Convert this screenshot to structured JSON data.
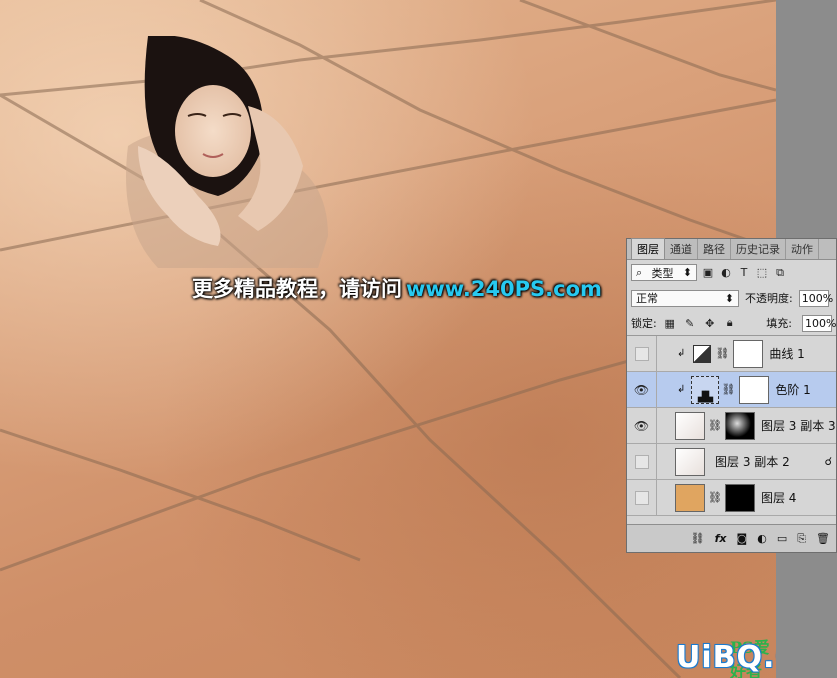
{
  "watermark": {
    "text_cn": "更多精品教程，请访问",
    "url": "www.240PS.com"
  },
  "logo": {
    "text": "UiBQ.CoM",
    "sub": "PS爱好者"
  },
  "panel": {
    "tabs": [
      "图层",
      "通道",
      "路径",
      "历史记录",
      "动作"
    ],
    "active_tab": "图层",
    "filter": {
      "label": "类型",
      "search_icon": "search-icon"
    },
    "blend_mode": "正常",
    "opacity_label": "不透明度:",
    "opacity_value": "100%",
    "lock_label": "锁定:",
    "fill_label": "填充:",
    "fill_value": "100%",
    "layers": [
      {
        "name": "曲线 1",
        "visible": false,
        "selected": false
      },
      {
        "name": "色阶 1",
        "visible": true,
        "selected": true
      },
      {
        "name": "图层 3 副本 3",
        "visible": true,
        "selected": false
      },
      {
        "name": "图层 3 副本 2",
        "visible": false,
        "selected": false
      },
      {
        "name": "图层 4",
        "visible": false,
        "selected": false
      }
    ],
    "footer_icons": [
      "link-icon",
      "fx-icon",
      "mask-icon",
      "adjustment-icon",
      "folder-icon",
      "new-layer-icon",
      "trash-icon"
    ],
    "footer_fx": "fx"
  },
  "colors": {
    "selected_layer": "#b7cbee",
    "url": "#27c9f0",
    "tile": "#d9a07a"
  }
}
